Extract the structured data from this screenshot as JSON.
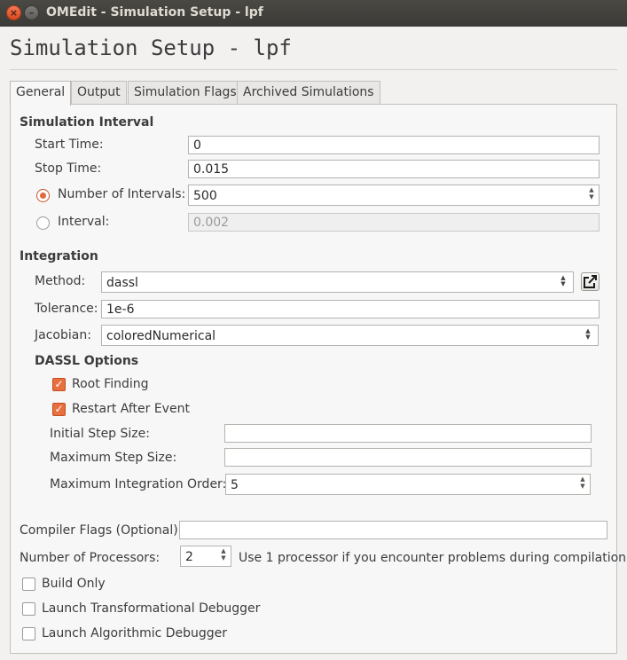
{
  "window": {
    "title": "OMEdit - Simulation Setup - lpf",
    "close_glyph": "×",
    "minimize_glyph": "–"
  },
  "heading": "Simulation Setup - lpf",
  "tabs": [
    {
      "label": "General",
      "active": true
    },
    {
      "label": "Output"
    },
    {
      "label": "Simulation Flags"
    },
    {
      "label": "Archived Simulations"
    }
  ],
  "interval": {
    "section_label": "Simulation Interval",
    "start_label": "Start Time:",
    "start_value": "0",
    "stop_label": "Stop Time:",
    "stop_value": "0.015",
    "num_intervals_label": "Number of Intervals:",
    "num_intervals_value": "500",
    "num_intervals_selected": true,
    "interval_label": "Interval:",
    "interval_value": "0.002"
  },
  "integration": {
    "section_label": "Integration",
    "method_label": "Method:",
    "method_value": "dassl",
    "tolerance_label": "Tolerance:",
    "tolerance_value": "1e-6",
    "jacobian_label": "Jacobian:",
    "jacobian_value": "coloredNumerical",
    "dassl": {
      "section_label": "DASSL Options",
      "root_finding_label": "Root Finding",
      "root_finding_checked": true,
      "restart_label": "Restart After Event",
      "restart_checked": true,
      "initial_step_label": "Initial Step Size:",
      "initial_step_value": "",
      "max_step_label": "Maximum Step Size:",
      "max_step_value": "",
      "max_order_label": "Maximum Integration Order:",
      "max_order_value": "5"
    }
  },
  "compiler_flags": {
    "label": "Compiler Flags (Optional):",
    "value": ""
  },
  "processors": {
    "label": "Number of Processors:",
    "value": "2",
    "hint": "Use 1 processor if you encounter problems during compilation."
  },
  "options": {
    "build_only_label": "Build Only",
    "transformational_debugger_label": "Launch Transformational Debugger",
    "algorithmic_debugger_label": "Launch Algorithmic Debugger"
  },
  "glyphs": {
    "up": "▲",
    "down": "▼",
    "check": "✓"
  },
  "colors": {
    "accent": "#e8703e",
    "titlebar": "#3b3a36",
    "background": "#f2f1f0"
  }
}
